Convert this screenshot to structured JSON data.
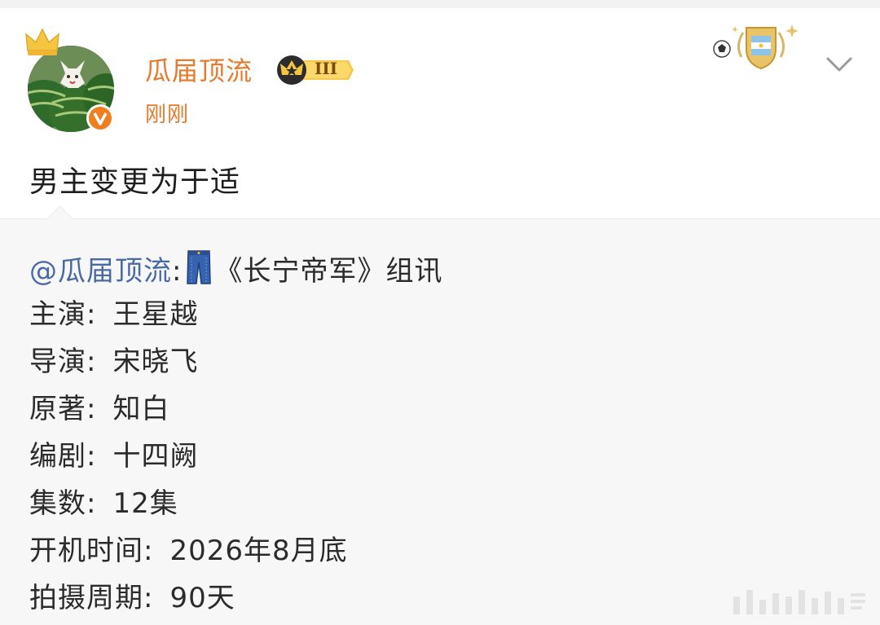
{
  "post": {
    "author": "瓜届顶流",
    "level_label": "III",
    "time": "刚刚",
    "text": "男主变更为于适"
  },
  "repost": {
    "mention": "@瓜届顶流",
    "colon": ":",
    "title": "《长宁帝军》组讯",
    "lines": [
      {
        "key": "主演:",
        "value": "王星越"
      },
      {
        "key": "导演:",
        "value": "宋晓飞"
      },
      {
        "key": "原著:",
        "value": "知白"
      },
      {
        "key": "编剧:",
        "value": "十四阙"
      },
      {
        "key": "集数:",
        "value": "12集"
      },
      {
        "key": "开机时间:",
        "value": "2026年8月底"
      },
      {
        "key": "拍摄周期:",
        "value": "90天"
      }
    ]
  },
  "icons": {
    "crown": "crown-icon",
    "verified": "verified-v-icon",
    "level": "vip-crown-level-badge",
    "fan": "football-argentina-fan-badge",
    "more": "chevron-down-icon",
    "jeans": "jeans-emoji-icon"
  },
  "colors": {
    "username": "#e8782a",
    "mention": "#4a6aa5",
    "verified": "#f07d1e",
    "text": "#1f1f1f"
  }
}
